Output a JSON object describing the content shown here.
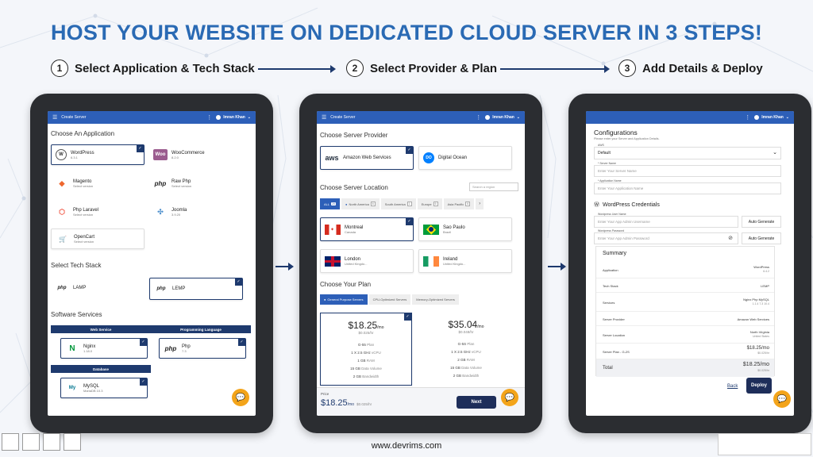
{
  "headline": "HOST YOUR WEBSITE ON DEDICATED CLOUD SERVER IN 3 STEPS!",
  "steps": [
    {
      "num": "1",
      "label": "Select Application & Tech Stack"
    },
    {
      "num": "2",
      "label": "Select Provider & Plan"
    },
    {
      "num": "3",
      "label": "Add Details & Deploy"
    }
  ],
  "appbar": {
    "title": "Create Server",
    "user": "Imran Khan"
  },
  "screen1": {
    "choose_app": "Choose An Application",
    "apps": [
      {
        "name": "WordPress",
        "sub": "6.3.1",
        "logo": "W"
      },
      {
        "name": "WooCommerce",
        "sub": "8.2.0",
        "logo": "Woo"
      },
      {
        "name": "Magento",
        "sub": "Select version",
        "logo": "M"
      },
      {
        "name": "Raw Php",
        "sub": "Select version",
        "logo": "php"
      },
      {
        "name": "Php Laravel",
        "sub": "Select version",
        "logo": "L"
      },
      {
        "name": "Joomla",
        "sub": "3.9.20",
        "logo": "J"
      },
      {
        "name": "OpenCart",
        "sub": "Select version",
        "logo": "OC"
      }
    ],
    "tech_stack": "Select Tech Stack",
    "stacks": [
      {
        "name": "LAMP",
        "logo": "php"
      },
      {
        "name": "LEMP",
        "logo": "php"
      }
    ],
    "software_services": "Software Services",
    "web_service": "Web Service",
    "programming_language": "Programming Language",
    "database": "Database",
    "nginx": {
      "name": "Nginx",
      "sub": "1.18.0",
      "logo": "N"
    },
    "php": {
      "name": "Php",
      "sub": "7.3",
      "logo": "php"
    },
    "mysql": {
      "name": "MySQL",
      "sub": "MariaDB 10.3",
      "logo": "My"
    }
  },
  "screen2": {
    "choose_provider": "Choose Server Provider",
    "providers": [
      {
        "name": "Amazon Web Services",
        "logo": "aws"
      },
      {
        "name": "Digital Ocean",
        "logo": "DO"
      }
    ],
    "choose_location": "Choose Server Location",
    "search_placeholder": "Search a region",
    "region_tabs": [
      {
        "label": "ALL",
        "count": "20"
      },
      {
        "label": "North America",
        "count": "6"
      },
      {
        "label": "South America",
        "count": "1"
      },
      {
        "label": "Europe",
        "count": "6"
      },
      {
        "label": "Asia Pacific",
        "count": "6"
      }
    ],
    "locations": [
      {
        "name": "Montreal",
        "sub": "Canada"
      },
      {
        "name": "Sao Paulo",
        "sub": "Brazil"
      },
      {
        "name": "London",
        "sub": "United Kingdo..."
      },
      {
        "name": "Ireland",
        "sub": "United Kingdo..."
      }
    ],
    "choose_plan": "Choose Your Plan",
    "plan_tabs": [
      "General Purpose Servers",
      "CPU-Optimized Servers",
      "Memory-Optimized Servers"
    ],
    "plans": [
      {
        "price": "$18.25",
        "per": "/mo",
        "hourly": "$0.025/hr",
        "specs": [
          [
            "G-55",
            "Plan"
          ],
          [
            "1 X 2.5 GHz",
            "vCPU"
          ],
          [
            "1 GB",
            "RAM"
          ],
          [
            "15 GB",
            "Data Volume"
          ],
          [
            "2 GB",
            "Bandwidth"
          ]
        ]
      },
      {
        "price": "$35.04",
        "per": "/mo",
        "hourly": "$0.048/hr",
        "specs": [
          [
            "G-5S",
            "Plan"
          ],
          [
            "1 X 2.5 GHz",
            "vCPU"
          ],
          [
            "2 GB",
            "RAM"
          ],
          [
            "15 GB",
            "Data Volume"
          ],
          [
            "2 GB",
            "Bandwidth"
          ]
        ]
      }
    ],
    "footer": {
      "label": "Price",
      "price": "$18.25",
      "per": "/mo",
      "hourly": "$0.025/hr",
      "next": "Next"
    }
  },
  "screen3": {
    "configurations": "Configurations",
    "config_sub": "Please enter your Server and Application Details.",
    "aws_label": "AWS",
    "aws_value": "Default",
    "server_name_label": "* Server Name",
    "server_name_ph": "Enter Your Server Name",
    "app_name_label": "* Application Name",
    "app_name_ph": "Enter Your Application Name",
    "wp_credentials": "WordPress Credentials",
    "wp_user_label": "Wordpress User Name",
    "wp_user_ph": "Enter Your App Admin Username",
    "wp_pass_label": "Wordpress Password",
    "wp_pass_ph": "Enter Your App Admin Password",
    "auto_generate": "Auto Generate",
    "summary": "Summary",
    "rows": [
      {
        "k": "Application",
        "v": "WordPress",
        "v2": "6.4.2"
      },
      {
        "k": "Tech Stack",
        "v": "LEMP",
        "v2": ""
      },
      {
        "k": "Services",
        "v": "Nginx  Php  MySQL",
        "v2": "1.1.4   7.3   10.4"
      },
      {
        "k": "Server Provider",
        "v": "Amazon Web Services",
        "v2": ""
      },
      {
        "k": "Server Location",
        "v": "North Virginia",
        "v2": "United States"
      },
      {
        "k": "Server Plan - G-2S",
        "v": "$18.25/mo",
        "v2": "$0.025/hr"
      },
      {
        "k": "Total",
        "v": "$18.25/mo",
        "v2": "$0.025/hr"
      }
    ],
    "back": "Back",
    "deploy": "Deploy"
  },
  "caption": "www.devrims.com",
  "colors": {
    "accent": "#2a6ab4",
    "navy": "#1e3a6e",
    "chat": "#f3a41a"
  }
}
